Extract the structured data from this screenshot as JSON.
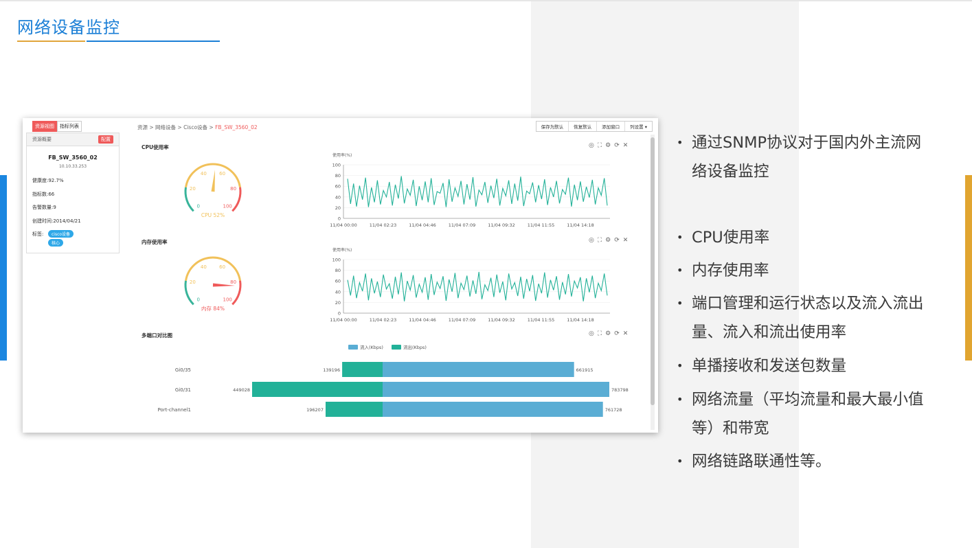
{
  "page": {
    "title": "网络设备监控"
  },
  "screenshot": {
    "tabs": [
      "资源视图",
      "指标列表"
    ],
    "breadcrumb": {
      "path": "资源 > 网络设备 > Cisco设备 > ",
      "current": "FB_SW_3560_02"
    },
    "toolbar": [
      "保存为默认",
      "恢复默认",
      "添加窗口",
      "列设置 ▾"
    ],
    "side_panel": {
      "header": "资源概要",
      "config_button": "配置",
      "device_name": "FB_SW_3560_02",
      "ip": "10.10.33.253",
      "health": "健康度:92.7%",
      "metrics": "指标数:66",
      "alarms": "告警数量:9",
      "created": "创建时间:2014/04/21",
      "tags_label": "标签:",
      "tags": [
        "cisco设备",
        "核心"
      ]
    },
    "sections": [
      {
        "title": "CPU使用率"
      },
      {
        "title": "内存使用率"
      },
      {
        "title": "多端口对比图"
      }
    ],
    "panel_icons": [
      "target-icon",
      "expand-icon",
      "gear-icon",
      "refresh-icon",
      "close-icon"
    ]
  },
  "chart_data": [
    {
      "type": "gauge",
      "title": "CPU使用率",
      "value": 52,
      "label": "CPU 52%",
      "ticks": [
        "0",
        "20",
        "40",
        "60",
        "80",
        "100"
      ],
      "range": [
        0,
        100
      ]
    },
    {
      "type": "line",
      "title": "CPU使用率",
      "ylabel": "使用率(%)",
      "ylim": [
        0,
        100
      ],
      "yticks": [
        "100",
        "80",
        "60",
        "40",
        "20",
        "0"
      ],
      "x": [
        "11/04 00:00",
        "11/04 02:23",
        "11/04 04:46",
        "11/04 07:09",
        "11/04 09:32",
        "11/04 11:55",
        "11/04 14:18"
      ],
      "values": [
        74,
        27,
        65,
        22,
        61,
        35,
        76,
        21,
        58,
        30,
        71,
        26,
        52,
        40,
        68,
        24,
        63,
        37,
        79,
        28,
        55,
        43,
        72,
        23,
        60,
        34,
        69,
        30,
        75,
        25,
        50,
        47,
        66,
        21,
        73,
        31,
        57,
        41,
        70,
        26,
        64,
        35,
        77,
        22,
        53,
        44,
        68,
        29,
        61,
        38,
        74,
        24,
        56,
        42,
        71,
        27,
        65,
        33,
        78,
        23,
        51,
        46,
        67,
        30,
        62,
        36,
        73,
        25,
        58,
        40,
        70,
        28,
        54,
        45,
        76,
        22,
        63,
        34,
        69,
        31,
        59,
        39,
        72,
        26,
        57,
        43,
        75,
        24
      ]
    },
    {
      "type": "gauge",
      "title": "内存使用率",
      "value": 84,
      "label": "内存 84%",
      "ticks": [
        "0",
        "20",
        "40",
        "60",
        "80",
        "100"
      ],
      "range": [
        0,
        100
      ]
    },
    {
      "type": "line",
      "title": "内存使用率",
      "ylabel": "使用率(%)",
      "ylim": [
        0,
        100
      ],
      "yticks": [
        "100",
        "80",
        "60",
        "40",
        "20",
        "0"
      ],
      "x": [
        "11/04 00:00",
        "11/04 02:23",
        "11/04 04:46",
        "11/04 07:09",
        "11/04 09:32",
        "11/04 11:55",
        "11/04 14:18"
      ],
      "values": [
        62,
        33,
        70,
        28,
        57,
        41,
        74,
        24,
        65,
        37,
        59,
        30,
        72,
        45,
        55,
        27,
        68,
        35,
        76,
        22,
        60,
        43,
        71,
        29,
        54,
        39,
        67,
        25,
        73,
        34,
        58,
        46,
        69,
        23,
        63,
        40,
        75,
        28,
        56,
        44,
        70,
        31,
        61,
        36,
        77,
        26,
        53,
        42,
        66,
        30,
        72,
        38,
        59,
        24,
        74,
        45,
        57,
        32,
        68,
        27,
        64,
        41,
        71,
        23,
        55,
        37,
        76,
        29,
        62,
        43,
        69,
        25,
        58,
        35,
        73,
        31,
        60,
        47,
        67,
        22,
        65,
        39,
        70,
        28,
        56,
        42,
        74,
        33
      ]
    },
    {
      "type": "bar",
      "title": "多端口对比图",
      "orientation": "horizontal-diverging",
      "categories": [
        "Gi0/35",
        "Gi0/31",
        "Port-channel1"
      ],
      "series": [
        {
          "name": "流入(Kbps)",
          "values": [
            661915,
            783798,
            761728
          ],
          "color": "#5aadd4"
        },
        {
          "name": "流出(Kbps)",
          "values": [
            139196,
            449028,
            196207
          ],
          "color": "#22b198"
        }
      ],
      "legend": "top"
    }
  ],
  "bullets": [
    "通过SNMP协议对于国内外主流网络设备监控",
    "CPU使用率",
    "内存使用率",
    "端口管理和运行状态以及流入流出量、流入和流出使用率",
    "单播接收和发送包数量",
    "网络流量（平均流量和最大最小值等）和带宽",
    "网络链路联通性等。"
  ],
  "bullet_marker": "•",
  "colors": {
    "accent_blue": "#1b7fd6",
    "accent_gold": "#e1a53a",
    "teal": "#22b198",
    "light_blue": "#5aadd4",
    "red": "#ef5a5a"
  }
}
